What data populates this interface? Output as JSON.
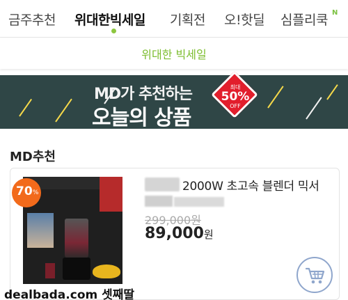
{
  "tabs": {
    "items": [
      "금주추천",
      "위대한빅세일",
      "기획전",
      "오!핫딜",
      "심플리쿡"
    ],
    "new_badge": "N"
  },
  "subbar": {
    "label": "위대한 빅세일"
  },
  "banner": {
    "subtitle": "MD가 추천하는",
    "title": "오늘의 상품",
    "badge_top": "최대",
    "badge_value": "50%",
    "badge_off": "OFF"
  },
  "section": {
    "title": "MD추천"
  },
  "product": {
    "discount_number": "70",
    "discount_unit": "%",
    "title": "2000W 초고속 블렌더 믹서",
    "original_price": "299,000원",
    "price_number": "89,000",
    "price_unit": "원"
  },
  "watermark": "dealbada.com  셋째딸",
  "colors": {
    "accent_green": "#7cbd2e",
    "banner_bg": "#2f4646",
    "sale_red": "#e21e2c",
    "discount_orange": "#f26a1b"
  }
}
